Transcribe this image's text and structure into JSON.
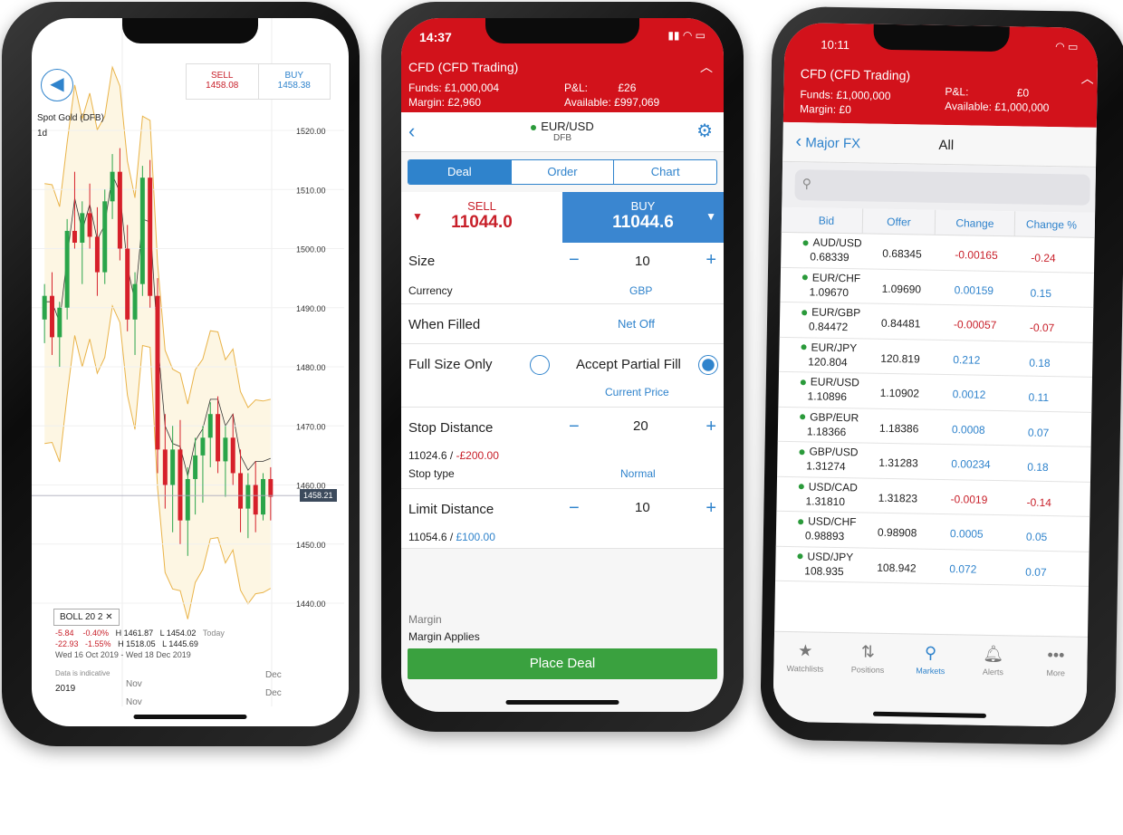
{
  "left": {
    "sell_label": "SELL",
    "sell_price": "1458.08",
    "buy_label": "BUY",
    "buy_price": "1458.38",
    "instrument": "Spot Gold (DFB)",
    "interval": "1d",
    "current_price_tag": "1458.21",
    "indicator": {
      "name": "BOLL",
      "p1": "20",
      "p2": "2"
    },
    "stats": [
      [
        "-5.84",
        "-0.40%",
        "H 1461.87",
        "L 1454.02",
        "Today"
      ],
      [
        "-22.93",
        "-1.55%",
        "H 1518.05",
        "L 1445.69",
        ""
      ]
    ],
    "date_range": "Wed 16 Oct 2019 - Wed 18 Dec 2019",
    "disclaimer": "Data is indicative",
    "year": "2019",
    "months": [
      "Nov",
      "Dec"
    ],
    "chart_data": {
      "type": "candlestick",
      "y_ticks": [
        "1520.00",
        "1510.00",
        "1500.00",
        "1490.00",
        "1480.00",
        "1470.00",
        "1460.00",
        "1450.00",
        "1440.00"
      ],
      "ylim": [
        1440,
        1520
      ],
      "x_labels": [
        "Nov",
        "Dec"
      ],
      "candles": [
        [
          1488,
          1494,
          1484,
          1492
        ],
        [
          1492,
          1496,
          1482,
          1485
        ],
        [
          1485,
          1491,
          1480,
          1490
        ],
        [
          1490,
          1505,
          1488,
          1503
        ],
        [
          1503,
          1513,
          1500,
          1501
        ],
        [
          1501,
          1508,
          1494,
          1506
        ],
        [
          1506,
          1511,
          1500,
          1502
        ],
        [
          1502,
          1507,
          1492,
          1496
        ],
        [
          1496,
          1510,
          1494,
          1508
        ],
        [
          1508,
          1516,
          1505,
          1513
        ],
        [
          1513,
          1517,
          1498,
          1500
        ],
        [
          1500,
          1504,
          1486,
          1488
        ],
        [
          1488,
          1496,
          1482,
          1494
        ],
        [
          1494,
          1514,
          1492,
          1512
        ],
        [
          1512,
          1515,
          1490,
          1492
        ],
        [
          1492,
          1495,
          1462,
          1466
        ],
        [
          1466,
          1472,
          1456,
          1460
        ],
        [
          1460,
          1470,
          1452,
          1466
        ],
        [
          1466,
          1471,
          1450,
          1454
        ],
        [
          1454,
          1463,
          1448,
          1461
        ],
        [
          1461,
          1468,
          1455,
          1465
        ],
        [
          1465,
          1470,
          1457,
          1468
        ],
        [
          1468,
          1474,
          1463,
          1472
        ],
        [
          1472,
          1475,
          1462,
          1464
        ],
        [
          1464,
          1470,
          1458,
          1468
        ],
        [
          1468,
          1472,
          1460,
          1462
        ],
        [
          1462,
          1466,
          1452,
          1456
        ],
        [
          1456,
          1462,
          1451,
          1460
        ],
        [
          1460,
          1464,
          1452,
          1455
        ],
        [
          1455,
          1462,
          1454,
          1461
        ],
        [
          1461,
          1463,
          1454,
          1458
        ]
      ]
    }
  },
  "middle": {
    "time": "14:37",
    "account": "CFD (CFD Trading)",
    "funds_label": "Funds:",
    "funds": "£1,000,004",
    "pl_label": "P&L:",
    "pl": "£26",
    "margin_label": "Margin:",
    "margin": "£2,960",
    "available_label": "Available:",
    "available": "£997,069",
    "instrument": "EUR/USD",
    "instrument_type": "DFB",
    "tabs": [
      "Deal",
      "Order",
      "Chart"
    ],
    "sell_label": "SELL",
    "sell_price": "11044.0",
    "buy_label": "BUY",
    "buy_price": "11044.6",
    "size_label": "Size",
    "size": "10",
    "currency_label": "Currency",
    "currency": "GBP",
    "when_filled_label": "When Filled",
    "when_filled": "Net Off",
    "full_size_label": "Full Size Only",
    "partial_label": "Accept Partial Fill",
    "current_price": "Current Price",
    "stop_label": "Stop Distance",
    "stop": "20",
    "stop_level": "11024.6 / ",
    "stop_pl": "-£200.00",
    "stop_type_label": "Stop type",
    "stop_type": "Normal",
    "limit_label": "Limit Distance",
    "limit": "10",
    "limit_level": "11054.6 / ",
    "limit_pl": "£100.00",
    "margin_section": "Margin",
    "margin_applies": "Margin Applies",
    "place_deal": "Place Deal",
    "colors": {
      "header": "#d2121b",
      "accent": "#2f83cc",
      "buy": "#3a86d0",
      "place": "#3aa13f"
    }
  },
  "right": {
    "time": "10:11",
    "account": "CFD (CFD Trading)",
    "funds_label": "Funds:",
    "funds": "£1,000,000",
    "pl_label": "P&L:",
    "pl": "£0",
    "margin_label": "Margin:",
    "margin": "£0",
    "available_label": "Available:",
    "available": "£1,000,000",
    "back_label": "Major FX",
    "title": "All",
    "columns": [
      "Bid",
      "Offer",
      "Change",
      "Change %"
    ],
    "rows": [
      {
        "name": "AUD/USD",
        "bid": "0.68339",
        "offer": "0.68345",
        "change": "-0.00165",
        "pct": "-0.24",
        "up": false
      },
      {
        "name": "EUR/CHF",
        "bid": "1.09670",
        "offer": "1.09690",
        "change": "0.00159",
        "pct": "0.15",
        "up": true
      },
      {
        "name": "EUR/GBP",
        "bid": "0.84472",
        "offer": "0.84481",
        "change": "-0.00057",
        "pct": "-0.07",
        "up": false
      },
      {
        "name": "EUR/JPY",
        "bid": "120.804",
        "offer": "120.819",
        "change": "0.212",
        "pct": "0.18",
        "up": true
      },
      {
        "name": "EUR/USD",
        "bid": "1.10896",
        "offer": "1.10902",
        "change": "0.0012",
        "pct": "0.11",
        "up": true
      },
      {
        "name": "GBP/EUR",
        "bid": "1.18366",
        "offer": "1.18386",
        "change": "0.0008",
        "pct": "0.07",
        "up": true
      },
      {
        "name": "GBP/USD",
        "bid": "1.31274",
        "offer": "1.31283",
        "change": "0.00234",
        "pct": "0.18",
        "up": true
      },
      {
        "name": "USD/CAD",
        "bid": "1.31810",
        "offer": "1.31823",
        "change": "-0.0019",
        "pct": "-0.14",
        "up": false
      },
      {
        "name": "USD/CHF",
        "bid": "0.98893",
        "offer": "0.98908",
        "change": "0.0005",
        "pct": "0.05",
        "up": true
      },
      {
        "name": "USD/JPY",
        "bid": "108.935",
        "offer": "108.942",
        "change": "0.072",
        "pct": "0.07",
        "up": true
      }
    ],
    "tabbar": [
      {
        "label": "Watchlists",
        "icon": "star-icon"
      },
      {
        "label": "Positions",
        "icon": "arrows-icon"
      },
      {
        "label": "Markets",
        "icon": "search-icon"
      },
      {
        "label": "Alerts",
        "icon": "bell-icon"
      },
      {
        "label": "More",
        "icon": "more-icon"
      }
    ]
  }
}
